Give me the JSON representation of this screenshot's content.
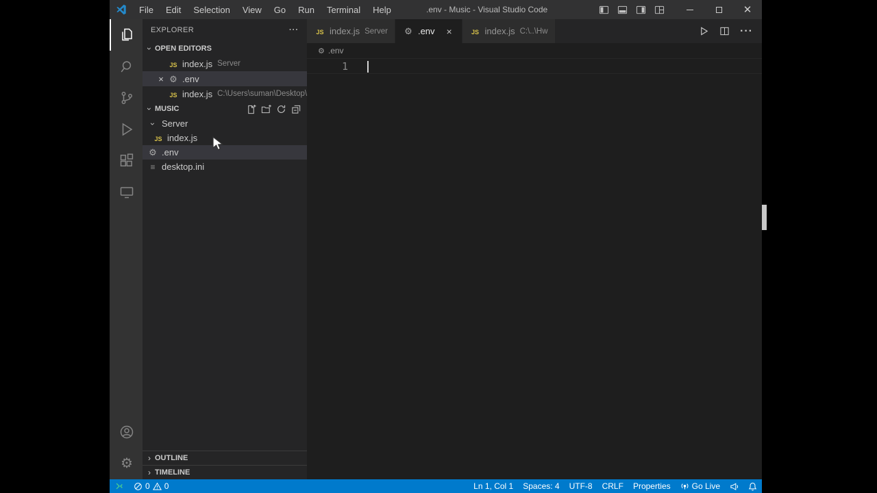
{
  "titlebar": {
    "menus": [
      "File",
      "Edit",
      "Selection",
      "View",
      "Go",
      "Run",
      "Terminal",
      "Help"
    ],
    "title": ".env - Music - Visual Studio Code"
  },
  "explorer": {
    "header": "EXPLORER",
    "open_editors_label": "OPEN EDITORS",
    "open_editors": [
      {
        "name": "index.js",
        "detail": "Server"
      },
      {
        "name": ".env",
        "detail": ""
      },
      {
        "name": "index.js",
        "detail": "C:\\Users\\suman\\Desktop\\Hw"
      }
    ],
    "project_label": "MUSIC",
    "tree": {
      "folder": "Server",
      "folder_child": "index.js",
      "env_file": ".env",
      "ini_file": "desktop.ini"
    },
    "outline_label": "OUTLINE",
    "timeline_label": "TIMELINE"
  },
  "editor": {
    "tabs": [
      {
        "name": "index.js",
        "detail": "Server"
      },
      {
        "name": ".env",
        "detail": ""
      },
      {
        "name": "index.js",
        "detail": "C:\\..\\Hw"
      }
    ],
    "breadcrumb": ".env",
    "line_number": "1"
  },
  "statusbar": {
    "errors": "0",
    "warnings": "0",
    "cursor_position": "Ln 1, Col 1",
    "indentation": "Spaces: 4",
    "encoding": "UTF-8",
    "eol": "CRLF",
    "language": "Properties",
    "go_live": "Go Live"
  }
}
